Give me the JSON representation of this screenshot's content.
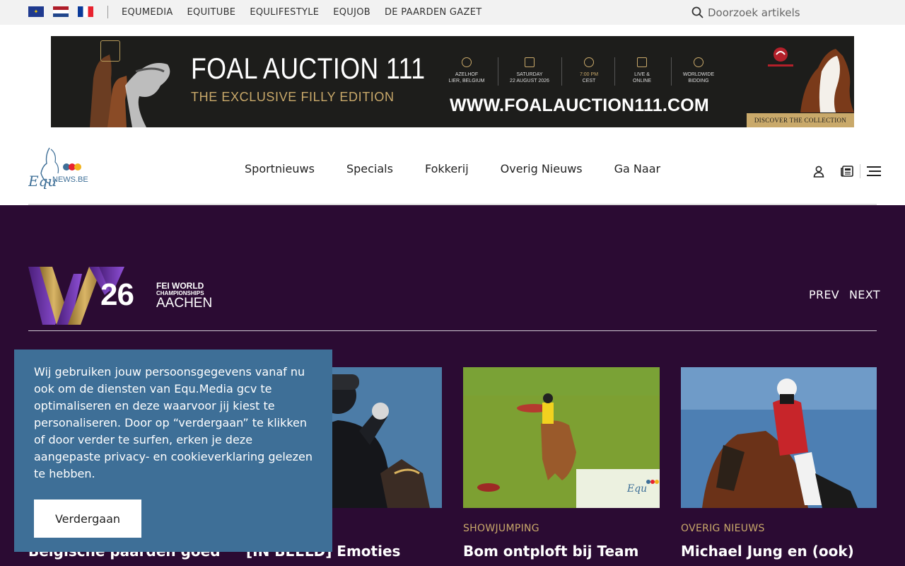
{
  "topbar": {
    "flags": [
      "eu-flag",
      "nl-flag",
      "fr-flag"
    ],
    "links": [
      "EQUMEDIA",
      "EQUITUBE",
      "EQULIFESTYLE",
      "EQUJOB",
      "DE PAARDEN GAZET"
    ],
    "search_placeholder": "Doorzoek artikels"
  },
  "banner": {
    "title": "FOAL AUCTION 111",
    "subtitle": "THE EXCLUSIVE FILLY EDITION",
    "info": [
      {
        "icon": "location-icon",
        "line1": "AZELHOF",
        "line2": "LIER, BELGIUM"
      },
      {
        "icon": "calendar-icon",
        "line1": "SATURDAY",
        "line2": "22 AUGUST 2026"
      },
      {
        "icon": "clock-icon",
        "line1": "7:00 PM",
        "line2": "CEST"
      },
      {
        "icon": "monitor-icon",
        "line1": "LIVE &",
        "line2": "ONLINE"
      },
      {
        "icon": "globe-icon",
        "line1": "WORLDWIDE",
        "line2": "BIDDING"
      }
    ],
    "url": "WWW.FOALAUCTION111.COM",
    "cta": "DISCOVER THE COLLECTION",
    "gold": "#c9a96a"
  },
  "header": {
    "logo_text": "NEWS.BE",
    "nav": [
      "Sportnieuws",
      "Specials",
      "Fokkerij",
      "Overig Nieuws",
      "Ga Naar"
    ],
    "icons": [
      "user-icon",
      "newspaper-icon",
      "menu-icon"
    ]
  },
  "section": {
    "logo_number": "26",
    "logo_fei": "FEI WORLD",
    "logo_champ": "CHAMPIONSHIPS",
    "logo_city": "AACHEN",
    "prev": "PREV",
    "next": "NEXT",
    "background": "#2b0b33"
  },
  "cards": [
    {
      "category": "",
      "title": "Belgische paarden goed"
    },
    {
      "category": "",
      "title": "[IN BEELD] Emoties"
    },
    {
      "category": "SHOWJUMPING",
      "title": "Bom ontploft bij Team"
    },
    {
      "category": "OVERIG NIEUWS",
      "title": "Michael Jung en (ook)"
    }
  ],
  "cookie": {
    "text": "Wij gebruiken jouw persoonsgegevens vanaf nu ook om de diensten van Equ.Media gcv te optimaliseren en deze waarvoor jij kiest te personaliseren. Door op “verdergaan” te klikken of door verder te surfen, erken je deze aangepaste privacy- en cookieverklaring gelezen te hebben.",
    "button": "Verdergaan",
    "background": "#3e6f97"
  }
}
